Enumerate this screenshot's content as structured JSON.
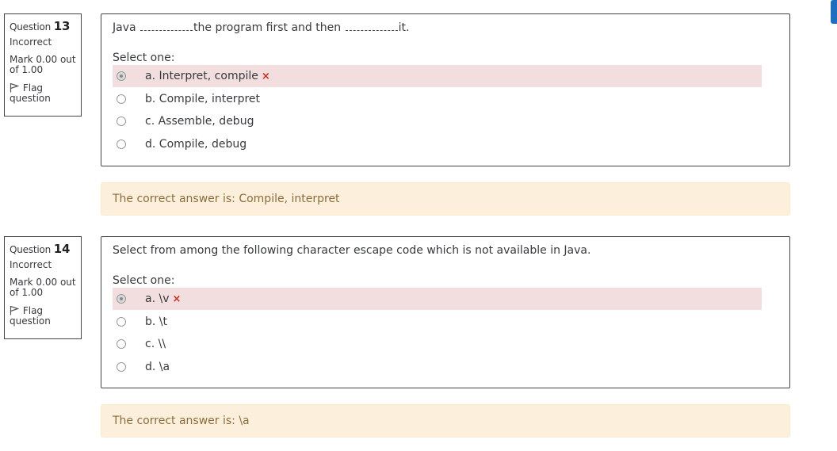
{
  "questions": [
    {
      "number_prefix": "Question",
      "number": "13",
      "state": "Incorrect",
      "grade": "Mark 0.00 out of 1.00",
      "flag_label": "Flag question",
      "text_parts": [
        "Java ",
        "the program first and then ",
        "it."
      ],
      "prompt": "Select one:",
      "options": [
        {
          "label": "a. Interpret, compile",
          "selected": true,
          "incorrect": true
        },
        {
          "label": "b. Compile, interpret",
          "selected": false,
          "incorrect": false
        },
        {
          "label": "c. Assemble, debug",
          "selected": false,
          "incorrect": false
        },
        {
          "label": "d. Compile, debug",
          "selected": false,
          "incorrect": false
        }
      ],
      "incorrect_mark": "×",
      "feedback": "The correct answer is: Compile, interpret"
    },
    {
      "number_prefix": "Question",
      "number": "14",
      "state": "Incorrect",
      "grade": "Mark 0.00 out of 1.00",
      "flag_label": "Flag question",
      "text": "Select from among the following character escape code which is not available in Java.",
      "prompt": "Select one:",
      "options": [
        {
          "label": "a. \\v",
          "selected": true,
          "incorrect": true
        },
        {
          "label": "b. \\t",
          "selected": false,
          "incorrect": false
        },
        {
          "label": "c. \\\\",
          "selected": false,
          "incorrect": false
        },
        {
          "label": "d. \\a",
          "selected": false,
          "incorrect": false
        }
      ],
      "incorrect_mark": "×",
      "feedback": "The correct answer is: \\a"
    }
  ],
  "colors": {
    "incorrect_bg": "#f2dede",
    "incorrect_mark": "#ca3120",
    "feedback_bg": "#fcefdc",
    "feedback_text": "#8a6d3b"
  },
  "icons": {
    "flag": "flag-outline-icon",
    "incorrect": "x-icon"
  }
}
